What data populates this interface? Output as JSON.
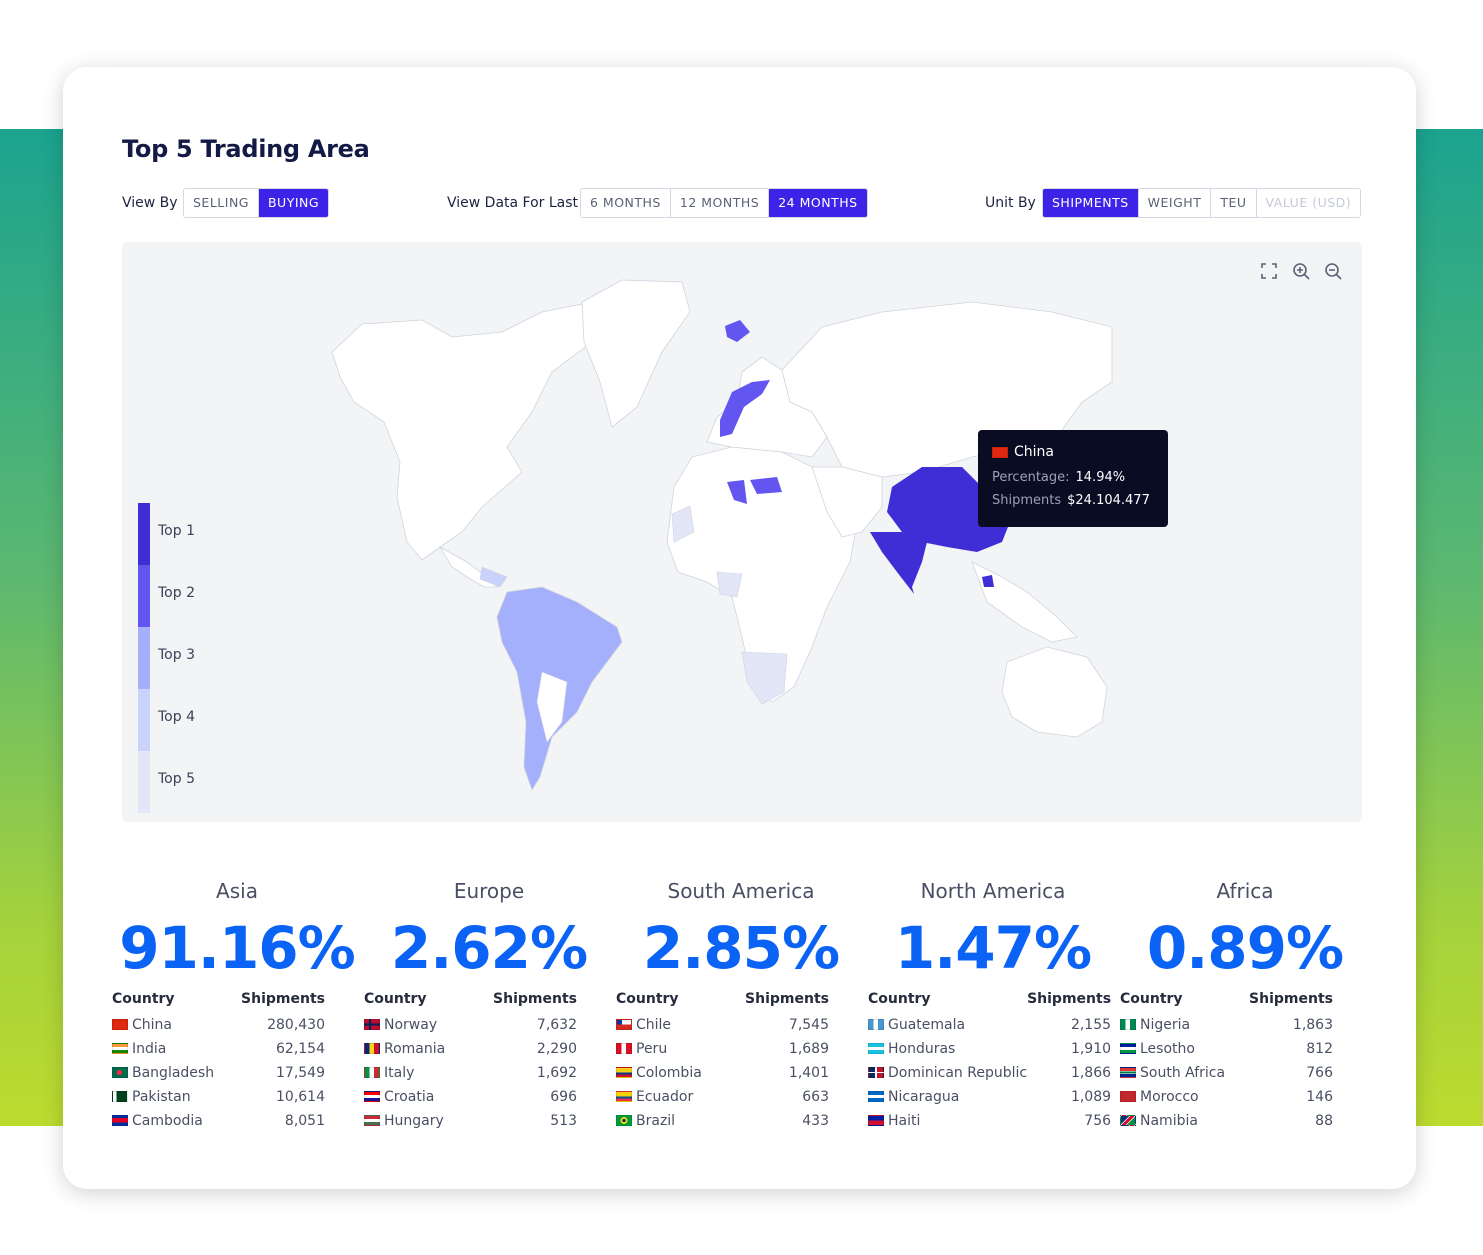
{
  "title": "Top 5 Trading Area",
  "view_by": {
    "label": "View By",
    "options": [
      "SELLING",
      "BUYING"
    ],
    "selected": "BUYING"
  },
  "period": {
    "label": "View Data For Last",
    "options": [
      "6 MONTHS",
      "12 MONTHS",
      "24 MONTHS"
    ],
    "selected": "24 MONTHS"
  },
  "unit_by": {
    "label": "Unit By",
    "options": [
      "SHIPMENTS",
      "WEIGHT",
      "TEU",
      "VALUE (USD)"
    ],
    "selected": "SHIPMENTS",
    "disabled": [
      "VALUE (USD)"
    ]
  },
  "map_tools": [
    "fullscreen-icon",
    "zoom-in-icon",
    "zoom-out-icon"
  ],
  "legend": [
    {
      "label": "Top 1",
      "color": "#3f2ed6"
    },
    {
      "label": "Top 2",
      "color": "#6355f0"
    },
    {
      "label": "Top 3",
      "color": "#a4b0fb"
    },
    {
      "label": "Top 4",
      "color": "#c9d2fb"
    },
    {
      "label": "Top 5",
      "color": "#e2e6f6"
    }
  ],
  "tooltip": {
    "country": "China",
    "percentage_label": "Percentage:",
    "percentage_value": "14.94%",
    "shipments_label": "Shipments",
    "shipments_value": "$24.104.477"
  },
  "columns": {
    "country": "Country",
    "shipments": "Shipments"
  },
  "regions": [
    {
      "name": "Asia",
      "percent": "91.16%",
      "rows": [
        {
          "country": "China",
          "shipments": "280,430",
          "flag": "cn"
        },
        {
          "country": "India",
          "shipments": "62,154",
          "flag": "in"
        },
        {
          "country": "Bangladesh",
          "shipments": "17,549",
          "flag": "bd"
        },
        {
          "country": "Pakistan",
          "shipments": "10,614",
          "flag": "pk"
        },
        {
          "country": "Cambodia",
          "shipments": "8,051",
          "flag": "kh"
        }
      ]
    },
    {
      "name": "Europe",
      "percent": "2.62%",
      "rows": [
        {
          "country": "Norway",
          "shipments": "7,632",
          "flag": "no"
        },
        {
          "country": "Romania",
          "shipments": "2,290",
          "flag": "ro"
        },
        {
          "country": "Italy",
          "shipments": "1,692",
          "flag": "it"
        },
        {
          "country": "Croatia",
          "shipments": "696",
          "flag": "hr"
        },
        {
          "country": "Hungary",
          "shipments": "513",
          "flag": "hu"
        }
      ]
    },
    {
      "name": "South America",
      "percent": "2.85%",
      "rows": [
        {
          "country": "Chile",
          "shipments": "7,545",
          "flag": "cl"
        },
        {
          "country": "Peru",
          "shipments": "1,689",
          "flag": "pe"
        },
        {
          "country": "Colombia",
          "shipments": "1,401",
          "flag": "co"
        },
        {
          "country": "Ecuador",
          "shipments": "663",
          "flag": "ec"
        },
        {
          "country": "Brazil",
          "shipments": "433",
          "flag": "br"
        }
      ]
    },
    {
      "name": "North America",
      "percent": "1.47%",
      "rows": [
        {
          "country": "Guatemala",
          "shipments": "2,155",
          "flag": "gt"
        },
        {
          "country": "Honduras",
          "shipments": "1,910",
          "flag": "hn"
        },
        {
          "country": "Dominican Republic",
          "shipments": "1,866",
          "flag": "do"
        },
        {
          "country": "Nicaragua",
          "shipments": "1,089",
          "flag": "ni"
        },
        {
          "country": "Haiti",
          "shipments": "756",
          "flag": "ht"
        }
      ]
    },
    {
      "name": "Africa",
      "percent": "0.89%",
      "rows": [
        {
          "country": "Nigeria",
          "shipments": "1,863",
          "flag": "ng"
        },
        {
          "country": "Lesotho",
          "shipments": "812",
          "flag": "ls"
        },
        {
          "country": "South Africa",
          "shipments": "766",
          "flag": "za"
        },
        {
          "country": "Morocco",
          "shipments": "146",
          "flag": "ma"
        },
        {
          "country": "Namibia",
          "shipments": "88",
          "flag": "na"
        }
      ]
    }
  ],
  "colors": {
    "accent": "#3d22e8",
    "percent_blue": "#0b63f5",
    "tooltip_bg": "#0a0c24"
  }
}
